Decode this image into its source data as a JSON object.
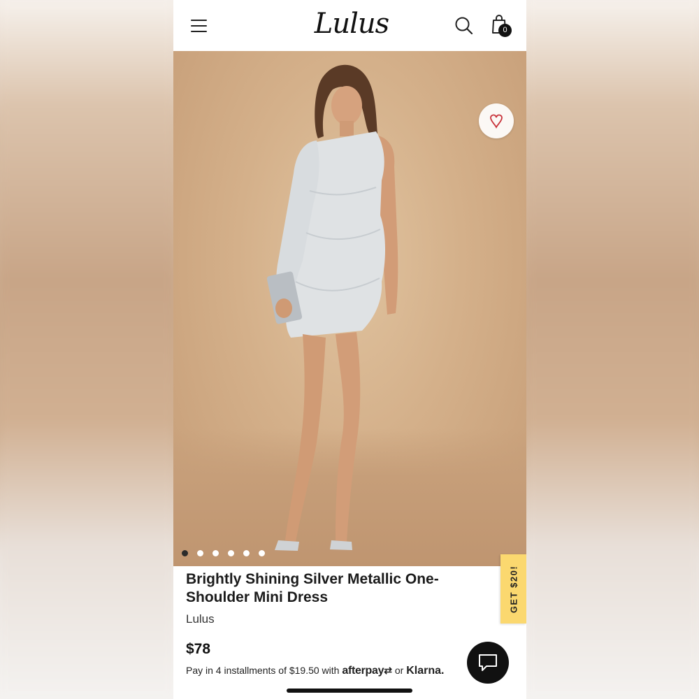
{
  "header": {
    "logo": "Lulus",
    "cart_count": "0",
    "icons": {
      "menu": "hamburger-menu-icon",
      "search": "search-icon",
      "cart": "shopping-bag-icon"
    }
  },
  "gallery": {
    "image_count": 6,
    "active_index": 0,
    "wishlist_icon": "heart-icon"
  },
  "product": {
    "title": "Brightly Shining Silver Metallic One-Shoulder Mini Dress",
    "brand": "Lulus",
    "price": "$78",
    "installments_prefix": "Pay in 4 installments of $19.50 with",
    "afterpay_label": "afterpay",
    "or_label": "or",
    "klarna_label": "Klarna."
  },
  "promo": {
    "label": "GET $20!",
    "color": "#fbd86f"
  },
  "chat": {
    "icon": "chat-bubble-icon"
  },
  "colors": {
    "wishlist_heart": "#c8323a",
    "text": "#1b1b1b",
    "chat_bg": "#111111"
  }
}
